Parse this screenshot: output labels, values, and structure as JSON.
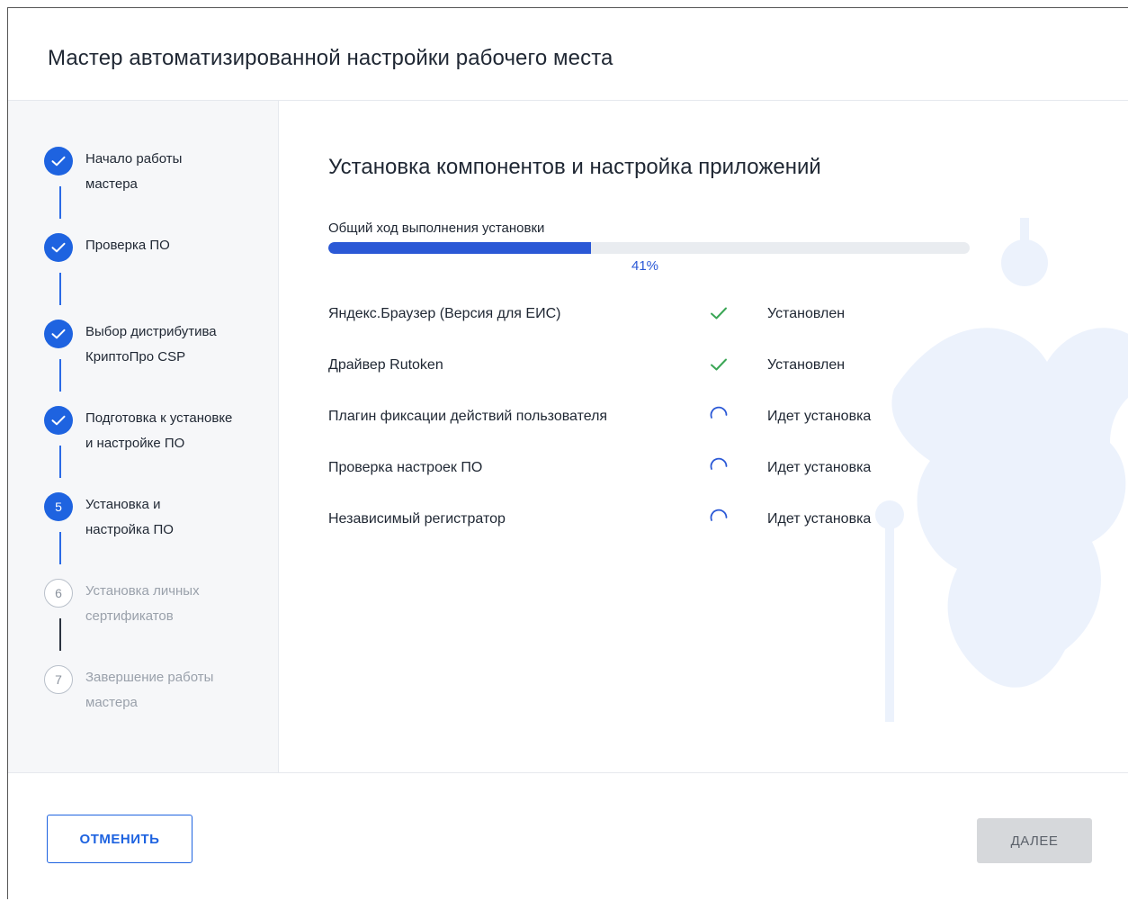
{
  "window": {
    "title": "Мастер автоматизированной настройки рабочего места"
  },
  "sidebar": {
    "steps": [
      {
        "number": "1",
        "label_line1": "Начало работы",
        "label_line2": "мастера",
        "state": "done"
      },
      {
        "number": "2",
        "label_line1": "Проверка ПО",
        "label_line2": "",
        "state": "done"
      },
      {
        "number": "3",
        "label_line1": "Выбор дистрибутива",
        "label_line2": "КриптоПро CSP",
        "state": "done"
      },
      {
        "number": "4",
        "label_line1": "Подготовка к установке",
        "label_line2": "и настройке ПО",
        "state": "done"
      },
      {
        "number": "5",
        "label_line1": "Установка и",
        "label_line2": "настройка ПО",
        "state": "current"
      },
      {
        "number": "6",
        "label_line1": "Установка личных",
        "label_line2": "сертификатов",
        "state": "pending"
      },
      {
        "number": "7",
        "label_line1": "Завершение работы",
        "label_line2": "мастера",
        "state": "pending"
      }
    ]
  },
  "main": {
    "title": "Установка компонентов и настройка приложений",
    "progress": {
      "label": "Общий ход выполнения установки",
      "percent_text": "41%",
      "fraction": 0.41
    },
    "components": [
      {
        "name": "Яндекс.Браузер (Версия для ЕИС)",
        "status": "Установлен",
        "icon": "check-icon"
      },
      {
        "name": "Драйвер Rutoken",
        "status": "Установлен",
        "icon": "check-icon"
      },
      {
        "name": "Плагин фиксации действий пользователя",
        "status": "Идет установка",
        "icon": "spinner-icon"
      },
      {
        "name": "Проверка настроек ПО",
        "status": "Идет установка",
        "icon": "spinner-icon"
      },
      {
        "name": "Независимый регистратор",
        "status": "Идет установка",
        "icon": "spinner-icon"
      }
    ]
  },
  "footer": {
    "cancel_label": "ОТМЕНИТЬ",
    "next_label": "ДАЛЕЕ"
  },
  "colors": {
    "accent": "#1e63e0",
    "progress": "#2a58d6",
    "success": "#3aa655",
    "disabled_button": "#d6d8db"
  }
}
